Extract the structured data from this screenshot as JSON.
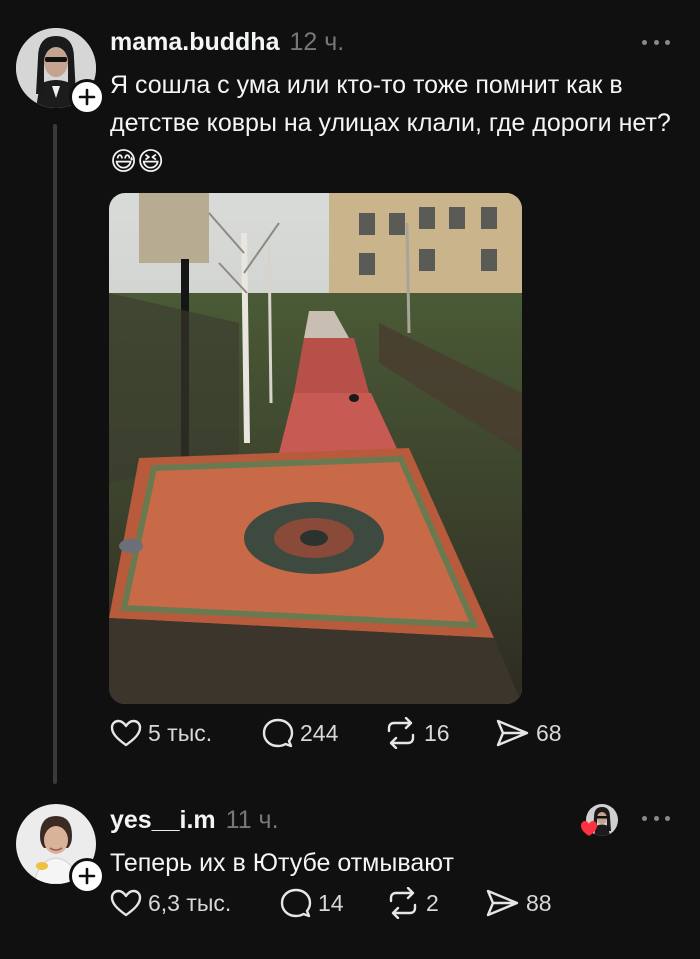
{
  "post": {
    "username": "mama.buddha",
    "time": "12 ч.",
    "text": "Я сошла с ума или кто-то тоже помнит как в детстве ковры на улицах клали, где дороги нет?",
    "emojis": "😅😆",
    "actions": {
      "likes": "5 тыс.",
      "replies": "244",
      "reposts": "16",
      "shares": "68"
    }
  },
  "reply": {
    "username": "yes__i.m",
    "time": "11 ч.",
    "text": "Теперь их в Ютубе отмывают",
    "actions": {
      "likes": "6,3 тыс.",
      "replies": "14",
      "reposts": "2",
      "shares": "88"
    }
  },
  "icons": {
    "like": "heart-icon",
    "reply": "comment-icon",
    "repost": "repost-icon",
    "share": "send-icon",
    "more": "more-icon",
    "follow": "plus-icon"
  },
  "colors": {
    "background": "#101010",
    "text": "#f3f5f7",
    "muted": "#777777",
    "like_red": "#ff3040"
  }
}
